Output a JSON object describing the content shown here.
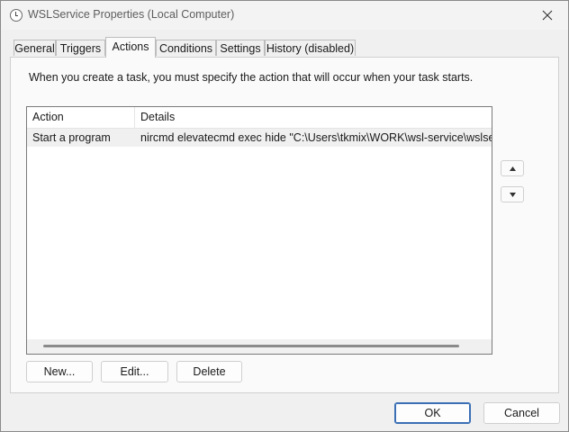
{
  "window": {
    "title": "WSLService Properties (Local Computer)"
  },
  "tabs": [
    {
      "label": "General"
    },
    {
      "label": "Triggers"
    },
    {
      "label": "Actions"
    },
    {
      "label": "Conditions"
    },
    {
      "label": "Settings"
    },
    {
      "label": "History (disabled)"
    }
  ],
  "active_tab": "Actions",
  "actions_panel": {
    "description": "When you create a task, you must specify the action that will occur when your task starts.",
    "columns": {
      "action": "Action",
      "details": "Details"
    },
    "rows": [
      {
        "action": "Start a program",
        "details": "nircmd elevatecmd exec hide \"C:\\Users\\tkmix\\WORK\\wsl-service\\wslservi"
      }
    ],
    "buttons": {
      "new": "New...",
      "edit": "Edit...",
      "delete": "Delete"
    }
  },
  "dialog_buttons": {
    "ok": "OK",
    "cancel": "Cancel"
  },
  "icons": {
    "title": "clock-icon",
    "close": "close-icon",
    "up": "arrow-up-icon",
    "down": "arrow-down-icon"
  }
}
